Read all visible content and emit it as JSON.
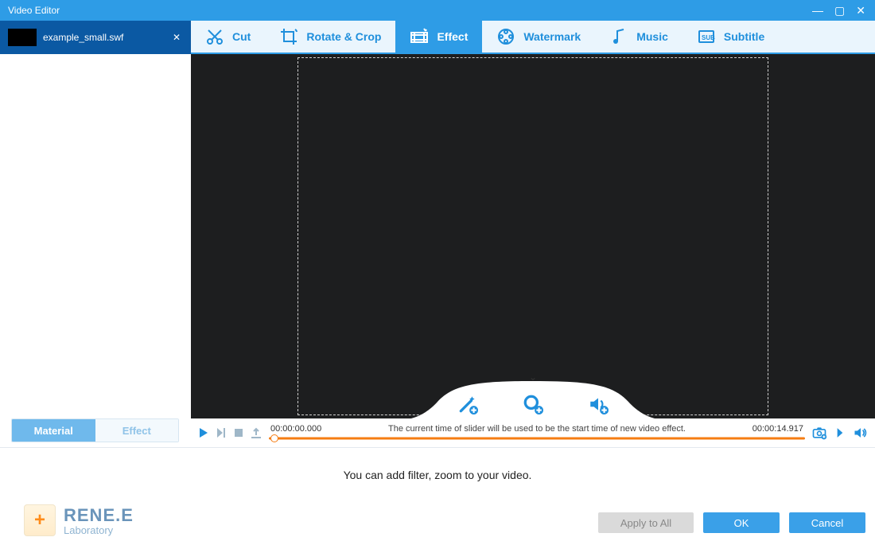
{
  "window": {
    "title": "Video Editor"
  },
  "file_tab": {
    "name": "example_small.swf"
  },
  "tool_tabs": {
    "cut": "Cut",
    "rotate": "Rotate & Crop",
    "effect": "Effect",
    "watermark": "Watermark",
    "music": "Music",
    "subtitle": "Subtitle",
    "active": "effect"
  },
  "segtabs": {
    "material": "Material",
    "effect": "Effect",
    "active": "material"
  },
  "timeline": {
    "start": "00:00:00.000",
    "end": "00:00:14.917",
    "hint": "The current time of slider will be used to be the start time of new video effect."
  },
  "footer": {
    "hint": "You can add filter, zoom to your video.",
    "apply_all": "Apply to All",
    "ok": "OK",
    "cancel": "Cancel",
    "brand_line1": "RENE.E",
    "brand_line2": "Laboratory"
  },
  "icons": {
    "wand": "wand-icon",
    "zoom": "zoom-icon",
    "volume": "volume-icon",
    "snapshot": "snapshot-icon",
    "speaker": "speaker-icon"
  }
}
